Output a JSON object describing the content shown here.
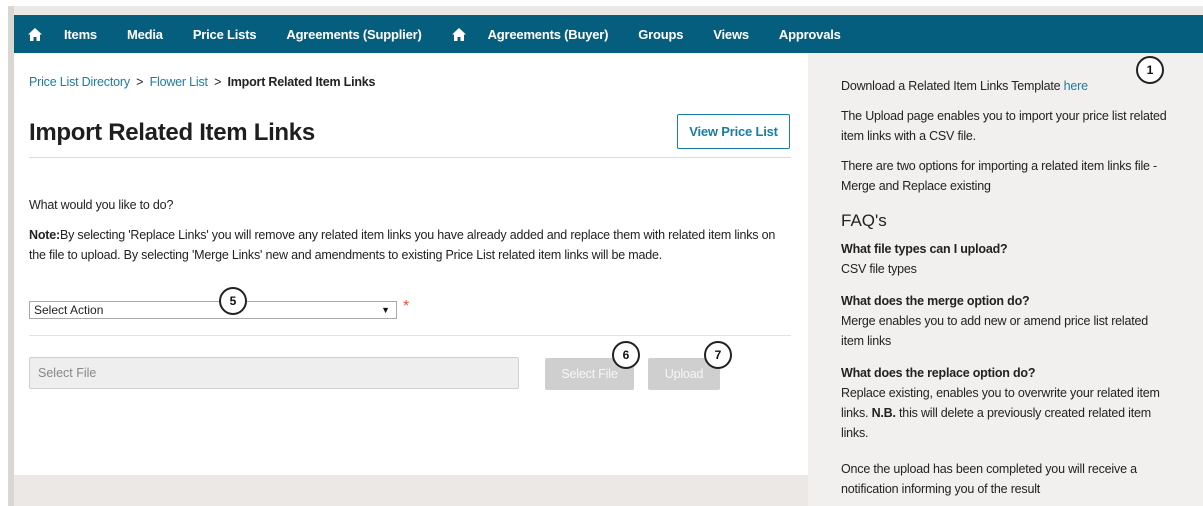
{
  "nav": {
    "items": [
      "Items",
      "Media",
      "Price Lists",
      "Agreements (Supplier)",
      "Agreements (Buyer)",
      "Groups",
      "Views",
      "Approvals"
    ],
    "home_icon": "home-icon"
  },
  "breadcrumb": {
    "link1": "Price List Directory",
    "sep1": ">",
    "link2": "Flower List",
    "sep2": ">",
    "current": "Import Related Item Links"
  },
  "page": {
    "title": "Import Related Item Links",
    "view_button": "View Price List",
    "question": "What would you like to do?",
    "note_label": "Note:",
    "note_text": "By selecting 'Replace Links' you will remove any related item links you have already added and replace them with related item links on the file to upload. By selecting 'Merge Links' new and amendments to existing Price List related item links will be made.",
    "select_value": "Select Action",
    "select_arrow": "▼",
    "required_mark": "*",
    "file_placeholder": "Select File",
    "select_file_button": "Select File",
    "upload_button": "Upload"
  },
  "callouts": [
    "1",
    "5",
    "6",
    "7"
  ],
  "sidebar": {
    "download_prefix": "Download a Related Item Links Template ",
    "download_link": "here",
    "p1": "The Upload page enables you to import your price list related item links with a CSV file.",
    "p2": "There are two options for importing a related item links file - Merge and Replace existing",
    "faq_heading": "FAQ's",
    "q1": "What file types can I upload?",
    "a1": "CSV file types",
    "q2": "What does the merge option do?",
    "a2": "Merge enables you to add new or amend price list related item links",
    "q3": "What does the replace option do?",
    "a3_prefix": "Replace existing, enables you to overwrite your related item links. ",
    "a3_bold": "N.B.",
    "a3_suffix": " this will delete a previously created related item links.",
    "p_last": "Once the upload has been completed you will receive a notification informing you of the result"
  },
  "colors": {
    "nav_bg": "#065e7e",
    "link": "#1b7ca4",
    "required": "#e8503e",
    "disabled_button": "#cfcfcf"
  }
}
